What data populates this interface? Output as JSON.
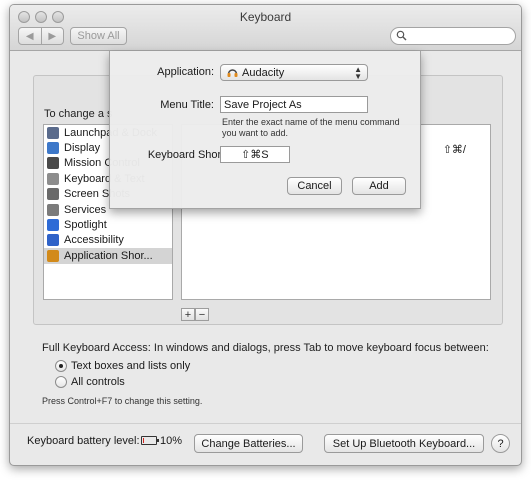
{
  "window": {
    "title": "Keyboard"
  },
  "toolbar": {
    "back_label": "◀",
    "forward_label": "▶",
    "show_all_label": "Show All",
    "search_placeholder": ""
  },
  "background_heading": "To change a s",
  "categories": [
    {
      "label": "Launchpad & Dock",
      "icon": "launchpad-icon",
      "color": "#5a6b8c"
    },
    {
      "label": "Display",
      "icon": "display-icon",
      "color": "#3d78c9"
    },
    {
      "label": "Mission Control",
      "icon": "mission-control-icon",
      "color": "#4a4a4a"
    },
    {
      "label": "Keyboard & Text",
      "icon": "keyboard-icon",
      "color": "#8d8d8d"
    },
    {
      "label": "Screen Shots",
      "icon": "screenshot-icon",
      "color": "#6a6a6a"
    },
    {
      "label": "Services",
      "icon": "services-icon",
      "color": "#7b7b7b"
    },
    {
      "label": "Spotlight",
      "icon": "spotlight-icon",
      "color": "#2e6bd6"
    },
    {
      "label": "Accessibility",
      "icon": "accessibility-icon",
      "color": "#2f62c8"
    },
    {
      "label": "Application Shor...",
      "icon": "app-shortcut-icon",
      "color": "#d28a1a",
      "selected": true
    }
  ],
  "shortcut_list": {
    "visible_shortcut": "⇧⌘/"
  },
  "list_buttons": {
    "add_label": "+",
    "remove_label": "−"
  },
  "full_keyboard_access": {
    "text": "Full Keyboard Access: In windows and dialogs, press Tab to move keyboard focus between:",
    "options": [
      {
        "label": "Text boxes and lists only",
        "selected": true
      },
      {
        "label": "All controls",
        "selected": false
      }
    ],
    "hint": "Press Control+F7 to change this setting."
  },
  "bottom": {
    "battery_label": "Keyboard battery level:",
    "battery_percent": "10%",
    "battery_level": 0.1,
    "change_batteries_label": "Change Batteries...",
    "setup_bluetooth_label": "Set Up Bluetooth Keyboard...",
    "help_label": "?"
  },
  "sheet": {
    "application_label": "Application:",
    "application_value": "Audacity",
    "menu_title_label": "Menu Title:",
    "menu_title_value": "Save Project As",
    "help_line1": "Enter the exact name of the menu command",
    "help_line2": "you want to add.",
    "shortcut_label": "Keyboard Shortcut:",
    "shortcut_value": "⇧⌘S",
    "cancel_label": "Cancel",
    "add_label": "Add"
  },
  "colors": {
    "accent": "#3d78c9",
    "battery_low": "#d8271f",
    "window_bg": "#e9e9e9"
  }
}
